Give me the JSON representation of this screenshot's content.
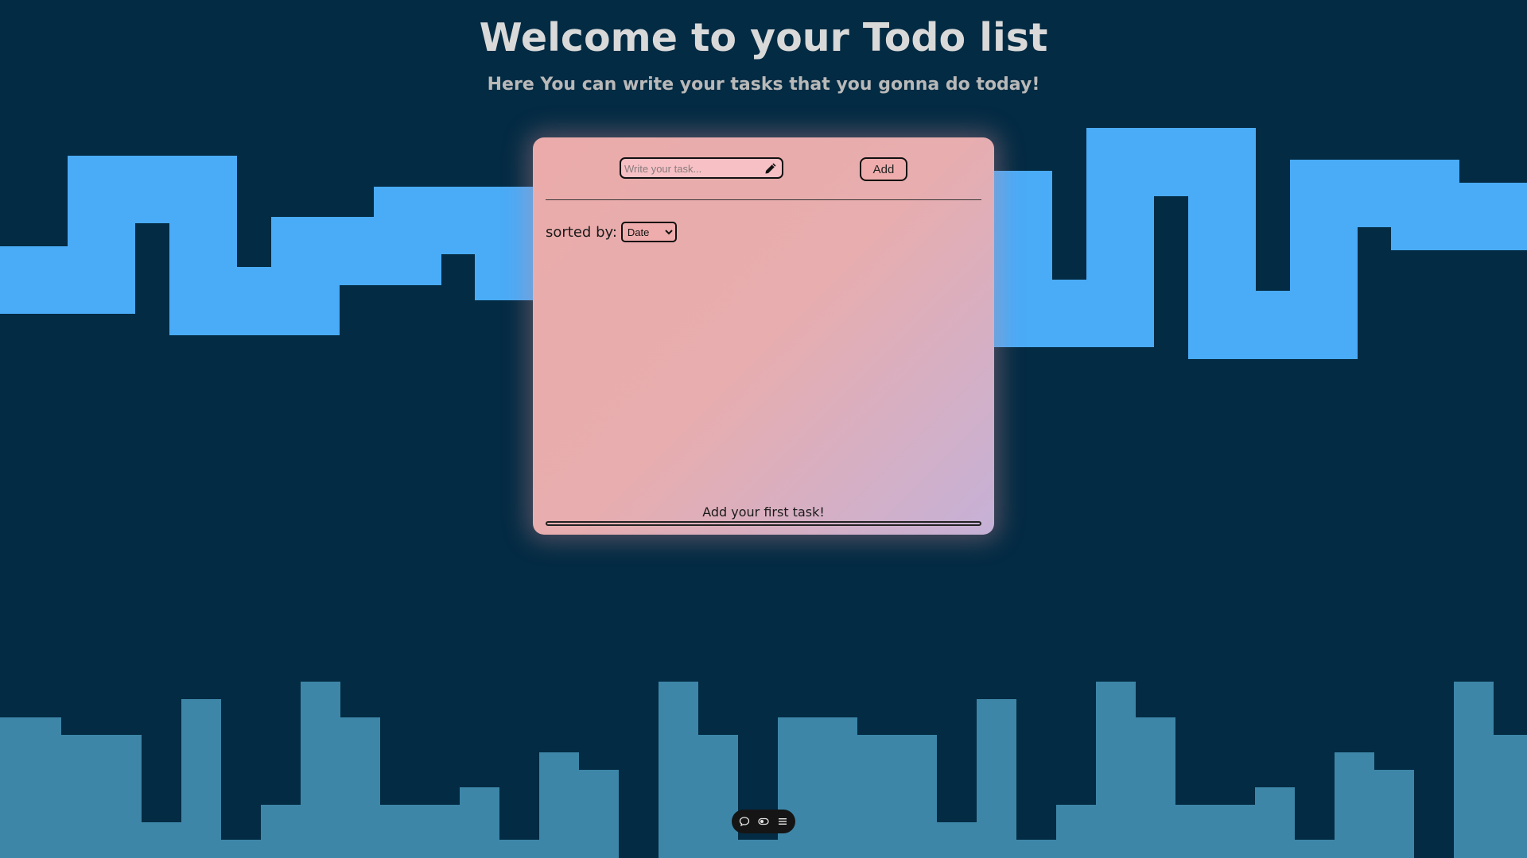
{
  "header": {
    "title": "Welcome to your Todo list",
    "subtitle": "Here You can write your tasks that you gonna do today!"
  },
  "task_form": {
    "input_placeholder": "Write your task...",
    "input_value": "",
    "input_icon": "pencil-icon",
    "add_label": "Add"
  },
  "sort": {
    "label": "sorted by:",
    "selected": "Date"
  },
  "task_list": {
    "empty_message": "Add your first task!",
    "progress_fraction": 0
  },
  "toolbar": {
    "icons": [
      "comment-icon",
      "toggle-icon",
      "menu-icon"
    ]
  },
  "colors": {
    "background": "#032b43",
    "wave_top": "#4aabf7",
    "skyline_bottom": "#3d86a8",
    "card_gradient_start": "#eaabaa",
    "card_gradient_end": "#c5b1d7",
    "title_text": "#d9d9d9"
  }
}
